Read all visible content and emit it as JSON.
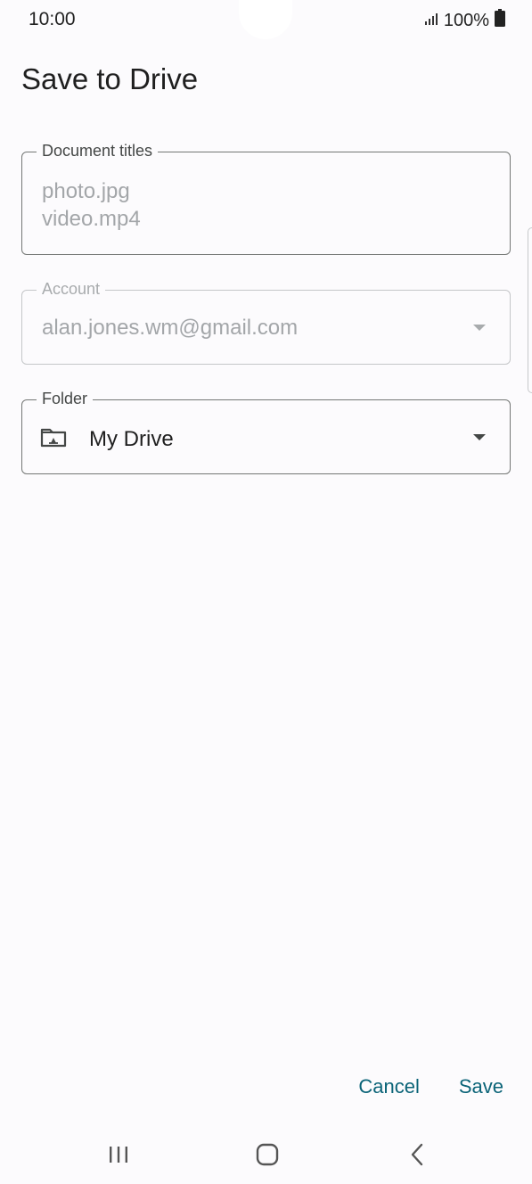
{
  "status_bar": {
    "time": "10:00",
    "battery": "100%",
    "icons": [
      "signal-icon",
      "battery-icon"
    ]
  },
  "dialog": {
    "title": "Save to Drive",
    "document_titles": {
      "label": "Document titles",
      "values": [
        "photo.jpg",
        "video.mp4"
      ]
    },
    "account": {
      "label": "Account",
      "value": "alan.jones.wm@gmail.com",
      "disabled": true
    },
    "folder": {
      "label": "Folder",
      "value": "My Drive",
      "icon": "shared-folder-icon"
    },
    "actions": {
      "cancel_label": "Cancel",
      "save_label": "Save"
    }
  },
  "colors": {
    "background": "#fcfbfd",
    "accent": "#0b6478",
    "outline": "#747775",
    "disabled": "#a3a6a9"
  },
  "nav_bar": {
    "icons": [
      "recents-icon",
      "home-icon",
      "back-icon"
    ]
  }
}
